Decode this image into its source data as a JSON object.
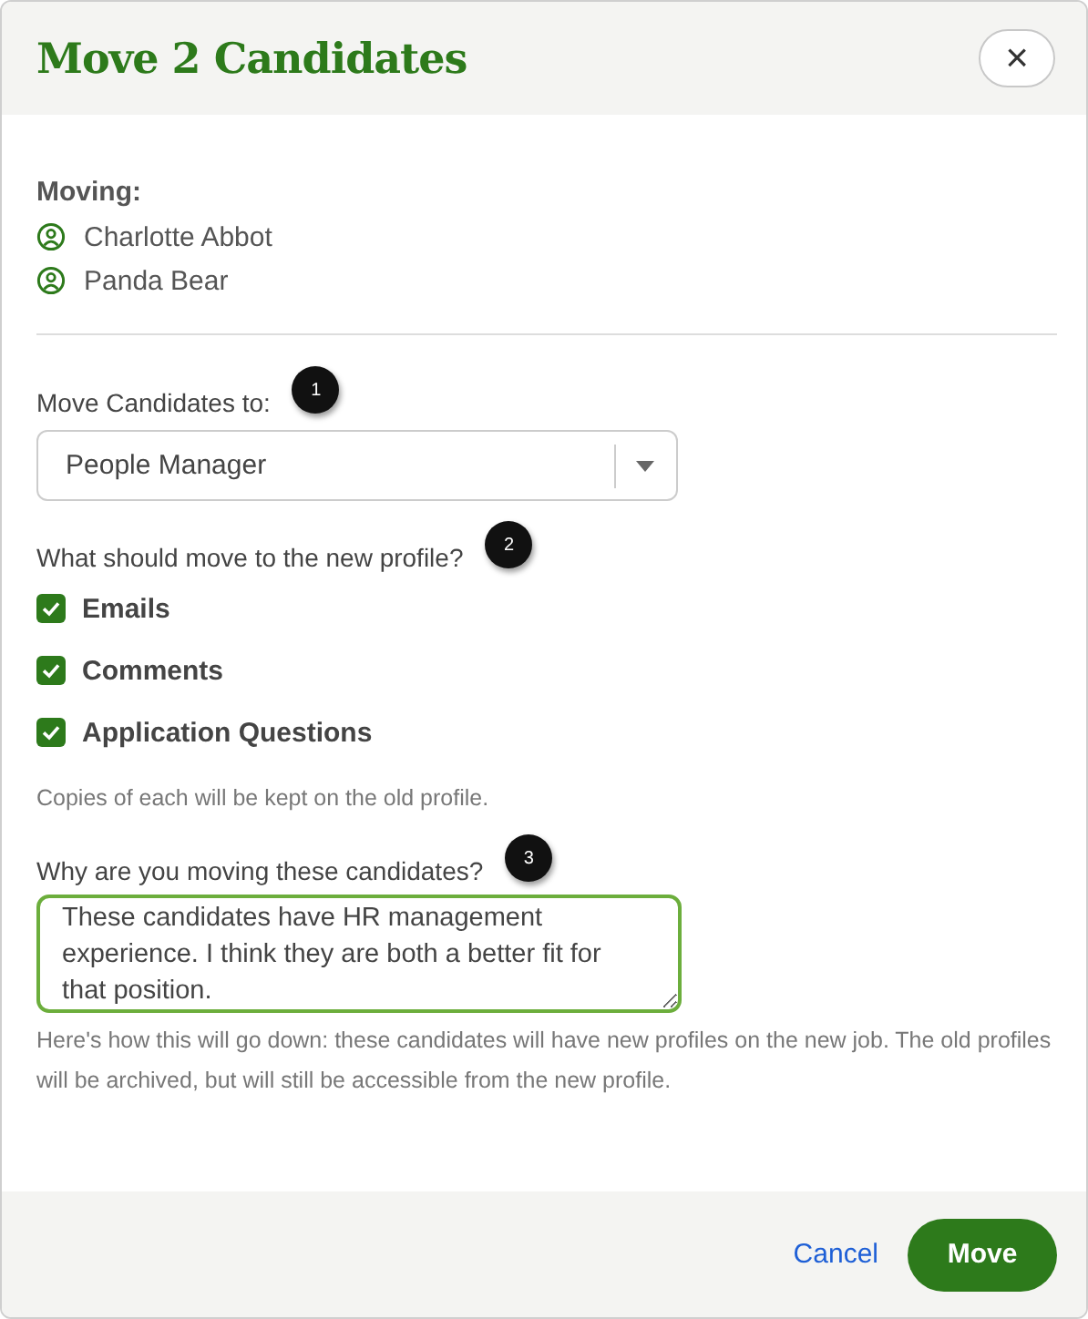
{
  "dialog": {
    "title": "Move 2 Candidates",
    "close": "×"
  },
  "moving": {
    "label": "Moving:",
    "candidates": [
      "Charlotte Abbot",
      "Panda Bear"
    ]
  },
  "destination": {
    "label": "Move Candidates to:",
    "step": "1",
    "value": "People Manager"
  },
  "transfer": {
    "label": "What should move to the new profile?",
    "step": "2",
    "options": [
      {
        "label": "Emails",
        "checked": true
      },
      {
        "label": "Comments",
        "checked": true
      },
      {
        "label": "Application Questions",
        "checked": true
      }
    ],
    "note": "Copies of each will be kept on the old profile."
  },
  "reason": {
    "label": "Why are you moving these candidates?",
    "step": "3",
    "value": "These candidates have HR management experience. I think they are both a better fit for that position.",
    "help": "Here's how this will go down: these candidates will have new profiles on the new job. The old profiles will be archived, but will still be accessible from the new profile."
  },
  "buttons": {
    "cancel": "Cancel",
    "confirm": "Move"
  }
}
